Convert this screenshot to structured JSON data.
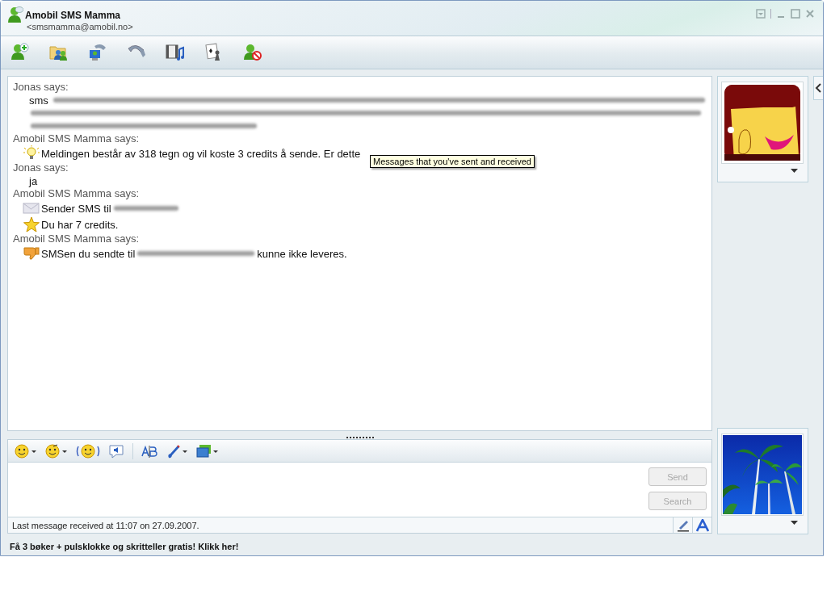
{
  "window": {
    "title": "Amobil SMS Mamma",
    "subtitle": "<smsmamma@amobil.no>"
  },
  "conversation": [
    {
      "sender": "Jonas says:",
      "lines": [
        {
          "kind": "plain",
          "segments": [
            {
              "kind": "text",
              "text": "sms"
            },
            {
              "kind": "redacted"
            }
          ]
        },
        {
          "kind": "plain",
          "segments": [
            {
              "kind": "redacted"
            }
          ]
        },
        {
          "kind": "plain",
          "segments": [
            {
              "kind": "redacted"
            }
          ]
        }
      ]
    },
    {
      "sender": "Amobil SMS Mamma says:",
      "lines": [
        {
          "kind": "tip",
          "segments": [
            {
              "kind": "text",
              "text": "Meldingen består av 318 tegn og vil koste 3 credits å sende. Er dette"
            }
          ]
        }
      ]
    },
    {
      "sender": "Jonas says:",
      "lines": [
        {
          "kind": "plain",
          "segments": [
            {
              "kind": "text",
              "text": "ja"
            }
          ]
        }
      ]
    },
    {
      "sender": "Amobil SMS Mamma says:",
      "lines": [
        {
          "kind": "sms",
          "segments": [
            {
              "kind": "text",
              "text": "Sender SMS til"
            },
            {
              "kind": "redacted"
            }
          ]
        },
        {
          "kind": "credits",
          "segments": [
            {
              "kind": "text",
              "text": "Du har 7 credits."
            }
          ]
        }
      ]
    },
    {
      "sender": "Amobil SMS Mamma says:",
      "lines": [
        {
          "kind": "failed",
          "segments": [
            {
              "kind": "text",
              "text": "SMSen du sendte til"
            },
            {
              "kind": "redacted"
            },
            {
              "kind": "text",
              "text": "kunne ikke leveres."
            }
          ]
        }
      ]
    }
  ],
  "tooltip": "Messages that you've sent and received",
  "compose": {
    "buttons": [
      {
        "label": "Send",
        "disabled": true
      },
      {
        "label": "Search",
        "disabled": true
      }
    ],
    "status": "Last message received at 11:07 on 27.09.2007."
  },
  "ad": "Få 3 bøker + pulsklokke og skritteller gratis! Klikk her!"
}
